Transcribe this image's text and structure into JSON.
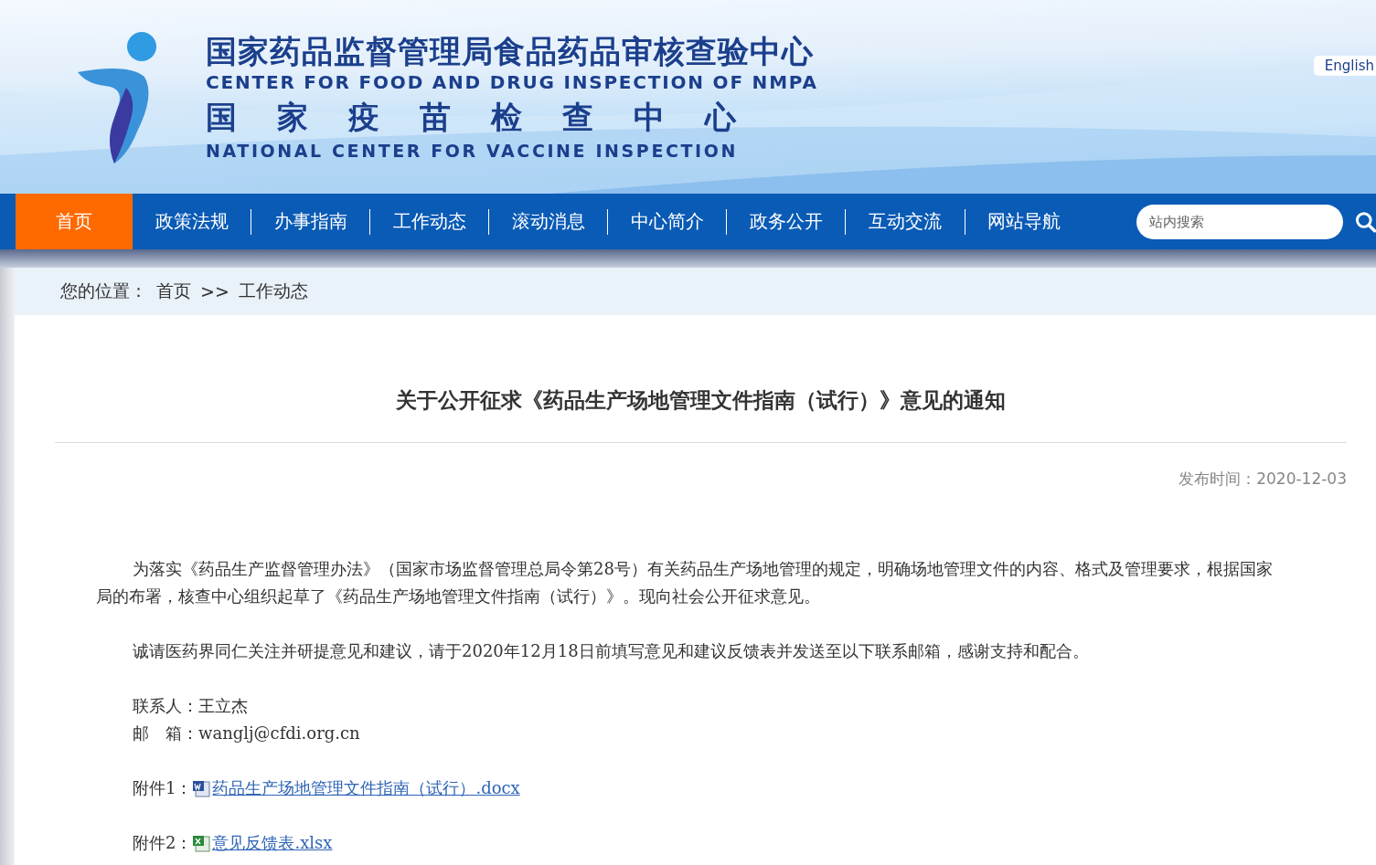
{
  "header": {
    "title_cn": "国家药品监督管理局食品药品审核查验中心",
    "title_en": "CENTER FOR FOOD AND DRUG INSPECTION OF NMPA",
    "subtitle_cn": "国家疫苗检查中心",
    "subtitle_en": "NATIONAL CENTER FOR VACCINE INSPECTION",
    "language_link": "English"
  },
  "nav": {
    "items": [
      {
        "label": "首页",
        "selected": true
      },
      {
        "label": "政策法规",
        "selected": false
      },
      {
        "label": "办事指南",
        "selected": false
      },
      {
        "label": "工作动态",
        "selected": false
      },
      {
        "label": "滚动消息",
        "selected": false
      },
      {
        "label": "中心简介",
        "selected": false
      },
      {
        "label": "政务公开",
        "selected": false
      },
      {
        "label": "互动交流",
        "selected": false
      },
      {
        "label": "网站导航",
        "selected": false
      }
    ],
    "search": {
      "placeholder": "站内搜索"
    }
  },
  "breadcrumb": {
    "label": "您的位置：",
    "items": [
      "首页",
      "工作动态"
    ],
    "separator": ">>"
  },
  "article": {
    "title": "关于公开征求《药品生产场地管理文件指南（试行）》意见的通知",
    "date": "发布时间：2020-12-03",
    "paragraphs": [
      "为落实《药品生产监督管理办法》（国家市场监督管理总局令第28号）有关药品生产场地管理的规定，明确场地管理文件的内容、格式及管理要求，根据国家局的布署，核查中心组织起草了《药品生产场地管理文件指南（试行）》。现向社会公开征求意见。",
      "诚请医药界同仁关注并研提意见和建议，请于2020年12月18日前填写意见和建议反馈表并发送至以下联系邮箱，感谢支持和配合。"
    ],
    "contacts": [
      "联系人：王立杰",
      "邮　箱：wanglj@cfdi.org.cn"
    ],
    "attachments": [
      {
        "label": "附件1：",
        "kind": "word",
        "file": "药品生产场地管理文件指南（试行）.docx"
      },
      {
        "label": "附件2：",
        "kind": "excel",
        "file": "意见反馈表.xlsx"
      }
    ]
  }
}
